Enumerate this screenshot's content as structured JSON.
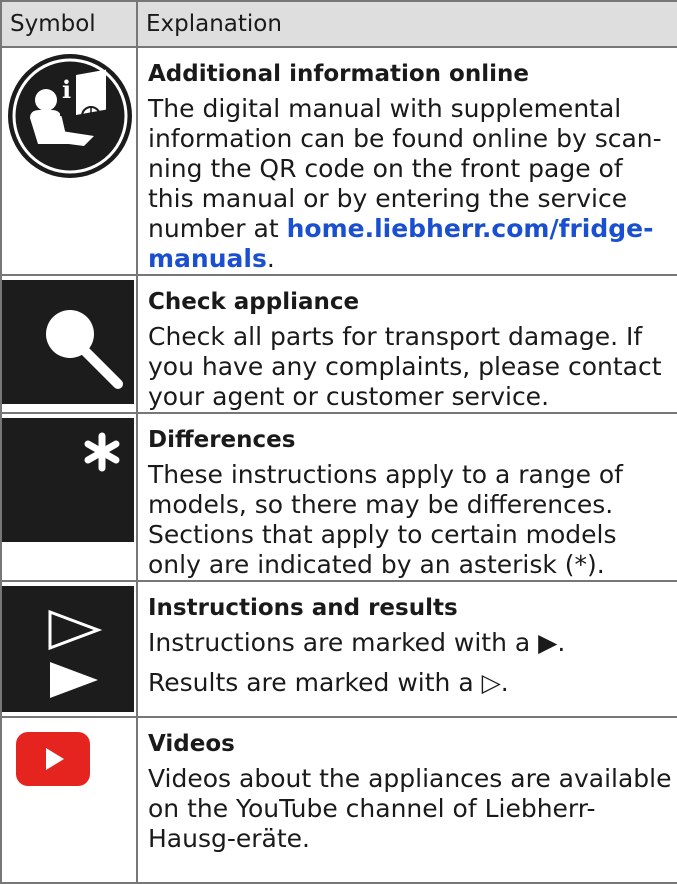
{
  "header": {
    "col_symbol": "Symbol",
    "col_explanation": "Explanation"
  },
  "rows": [
    {
      "icon": "info-online-icon",
      "title": "Additional information online",
      "text_before": "The digital manual with supplemental information can be found online by scan-ning the QR code on the front page of this manual or by entering the service number at ",
      "link": "home.liebherr.com/fridge-manuals",
      "text_after": "."
    },
    {
      "icon": "magnifier-icon",
      "title": "Check appliance",
      "text": "Check all parts for transport damage. If you have any complaints, please contact your agent or customer service."
    },
    {
      "icon": "asterisk-icon",
      "title": "Differences",
      "text": "These instructions apply to a range of models, so there may be differences. Sections that apply to certain models only are indicated by an asterisk (*)."
    },
    {
      "icon": "instruction-arrows-icon",
      "title": "Instructions and results",
      "line1": "Instructions are marked with a ▶.",
      "line2": "Results are marked with a ▷."
    },
    {
      "icon": "youtube-icon",
      "title": "Videos",
      "text": "Videos about the appliances are available on the YouTube channel of Liebherr-Hausg-eräte."
    }
  ],
  "colors": {
    "header_bg": "#dedede",
    "border": "#777777",
    "tile": "#1c1c1c",
    "link": "#1a4fd1",
    "youtube_red": "#e52420"
  }
}
